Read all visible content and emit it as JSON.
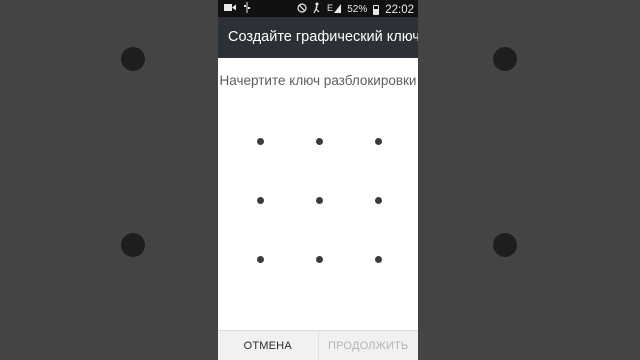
{
  "status_bar": {
    "battery": "52%",
    "time": "22:02",
    "icons": [
      "video-camera-icon",
      "usb-icon",
      "do-not-disturb-icon",
      "silent-icon",
      "network-e-icon",
      "signal-icon",
      "battery-icon"
    ]
  },
  "dialog": {
    "title": "Создайте графический ключ",
    "prompt": "Начертите ключ разблокировки",
    "cancel_label": "ОТМЕНА",
    "continue_label": "ПРОДОЛЖИТЬ"
  },
  "colors": {
    "title_bar": "#2b3136",
    "dot": "#3b3b3b",
    "disabled_text": "#b4b4b4"
  }
}
